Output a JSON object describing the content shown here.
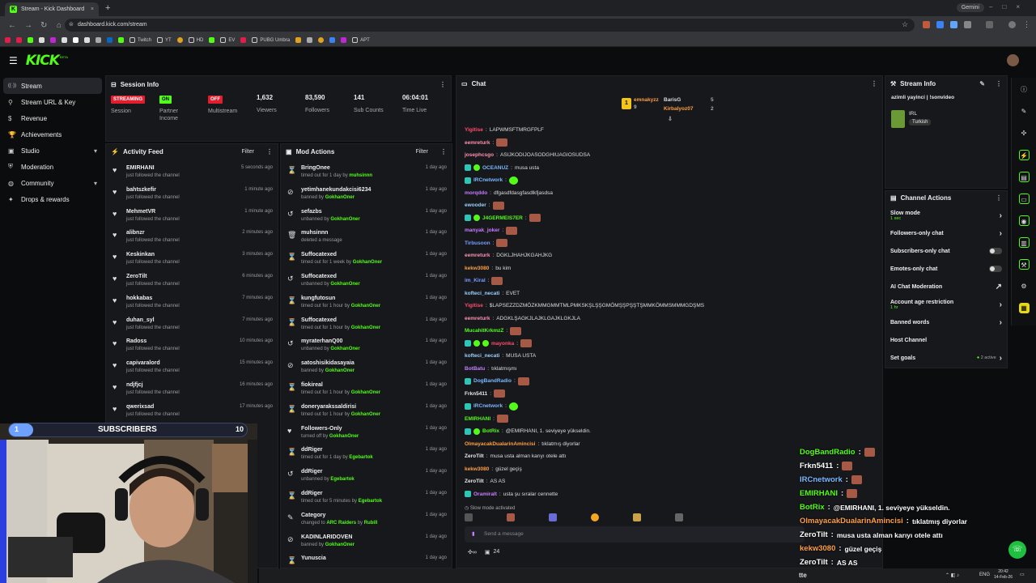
{
  "browser": {
    "tab_title": "Stream - Kick Dashboard",
    "tab_close": "×",
    "new_tab": "+",
    "url": "dashboard.kick.com/stream",
    "gemini_label": "Gemini",
    "bookmarks": [
      {
        "label": "Twitch",
        "color": "#9146ff"
      },
      {
        "label": "YT",
        "color": "#ff0000"
      },
      {
        "label": "HD",
        "color": "#e0a020"
      },
      {
        "label": "EV",
        "color": "#3b82f6"
      },
      {
        "label": "PUBG Umbra",
        "color": "#e11d48"
      },
      {
        "label": "APT",
        "color": "#aaaaaa"
      }
    ]
  },
  "app": {
    "logo": "KICK",
    "logo_beta": "BETA"
  },
  "nav": {
    "items": [
      {
        "label": "Stream",
        "icon": "stream-icon",
        "active": true
      },
      {
        "label": "Stream URL & Key",
        "icon": "key-icon"
      },
      {
        "label": "Revenue",
        "icon": "dollar-icon"
      },
      {
        "label": "Achievements",
        "icon": "trophy-icon"
      },
      {
        "label": "Studio",
        "icon": "studio-icon",
        "chevron": "▾"
      },
      {
        "label": "Moderation",
        "icon": "shield-icon"
      },
      {
        "label": "Community",
        "icon": "globe-icon",
        "chevron": "▾"
      },
      {
        "label": "Drops & rewards",
        "icon": "gift-icon"
      }
    ]
  },
  "session": {
    "title": "Session Info",
    "more": "⋮",
    "status": [
      {
        "badge": "STREAMING",
        "label": "Session",
        "color": "#e11d2e"
      },
      {
        "badge": "ON",
        "label": "Partner Income",
        "color": "#53fc18"
      },
      {
        "badge": "OFF",
        "label": "Multistream",
        "color": "#e11d2e"
      }
    ],
    "stats": [
      {
        "value": "1,632",
        "label": "Viewers"
      },
      {
        "value": "83,590",
        "label": "Followers"
      },
      {
        "value": "141",
        "label": "Sub Counts"
      },
      {
        "value": "06:04:01",
        "label": "Time Live"
      }
    ]
  },
  "activity": {
    "title": "Activity Feed",
    "filter": "Filter",
    "more": "⋮",
    "items": [
      {
        "name": "EMIRHANI",
        "sub": "just followed the channel",
        "time": "5 seconds ago"
      },
      {
        "name": "bahtszkefir",
        "sub": "just followed the channel",
        "time": "1 minute ago"
      },
      {
        "name": "MehmetVR",
        "sub": "just followed the channel",
        "time": "1 minute ago"
      },
      {
        "name": "alibnzr",
        "sub": "just followed the channel",
        "time": "2 minutes ago"
      },
      {
        "name": "Keskinkan",
        "sub": "just followed the channel",
        "time": "3 minutes ago"
      },
      {
        "name": "ZeroTilt",
        "sub": "just followed the channel",
        "time": "6 minutes ago"
      },
      {
        "name": "hokkabas",
        "sub": "just followed the channel",
        "time": "7 minutes ago"
      },
      {
        "name": "duhan_syl",
        "sub": "just followed the channel",
        "time": "7 minutes ago"
      },
      {
        "name": "Radoss",
        "sub": "just followed the channel",
        "time": "10 minutes ago"
      },
      {
        "name": "capivaralord",
        "sub": "just followed the channel",
        "time": "15 minutes ago"
      },
      {
        "name": "ndjfjcj",
        "sub": "just followed the channel",
        "time": "16 minutes ago"
      },
      {
        "name": "qwerixsad",
        "sub": "just followed the channel",
        "time": "17 minutes ago"
      }
    ]
  },
  "mod": {
    "title": "Mod Actions",
    "filter": "Filter",
    "more": "⋮",
    "items": [
      {
        "icon": "⌛",
        "name": "BringOnee",
        "pre": "timed out for 1 day by ",
        "by": "muhsinnn",
        "time": "1 day ago"
      },
      {
        "icon": "⊘",
        "name": "yetimhanekundakcisi6234",
        "pre": "banned by ",
        "by": "GokhanOner",
        "time": "1 day ago"
      },
      {
        "icon": "↺",
        "name": "sefazbs",
        "pre": "unbanned by ",
        "by": "GokhanOner",
        "time": "1 day ago"
      },
      {
        "icon": "🗑",
        "name": "muhsinnn",
        "pre": "deleted a message",
        "by": "",
        "time": "1 day ago"
      },
      {
        "icon": "⌛",
        "name": "Suffocatexed",
        "pre": "timed out for 1 week by ",
        "by": "GokhanOner",
        "time": "1 day ago"
      },
      {
        "icon": "↺",
        "name": "Suffocatexed",
        "pre": "unbanned by ",
        "by": "GokhanOner",
        "time": "1 day ago"
      },
      {
        "icon": "⌛",
        "name": "kungfutosun",
        "pre": "timed out for 1 hour by ",
        "by": "GokhanOner",
        "time": "1 day ago"
      },
      {
        "icon": "⌛",
        "name": "Suffocatexed",
        "pre": "timed out for 1 hour by ",
        "by": "GokhanOner",
        "time": "1 day ago"
      },
      {
        "icon": "↺",
        "name": "myraterhanQ00",
        "pre": "unbanned by ",
        "by": "GokhanOner",
        "time": "1 day ago"
      },
      {
        "icon": "⊘",
        "name": "satoshisikidasayaia",
        "pre": "banned by ",
        "by": "GokhanOner",
        "time": "1 day ago"
      },
      {
        "icon": "⌛",
        "name": "fiokireal",
        "pre": "timed out for 1 hour by ",
        "by": "GokhanOner",
        "time": "1 day ago"
      },
      {
        "icon": "⌛",
        "name": "doneryarakssaldirisi",
        "pre": "timed out for 1 hour by ",
        "by": "GokhanOner",
        "time": "1 day ago"
      },
      {
        "icon": "♥",
        "name": "Followers-Only",
        "pre": "turned off by ",
        "by": "GokhanOner",
        "time": "1 day ago"
      },
      {
        "icon": "⌛",
        "name": "ddRiger",
        "pre": "timed out for 1 day by ",
        "by": "Egebartok",
        "time": "1 day ago"
      },
      {
        "icon": "↺",
        "name": "ddRiger",
        "pre": "unbanned by ",
        "by": "Egebartok",
        "time": "1 day ago"
      },
      {
        "icon": "⌛",
        "name": "ddRiger",
        "pre": "timed out for 5 minutes by ",
        "by": "Egebartok",
        "time": "1 day ago"
      },
      {
        "icon": "✎",
        "name": "Category",
        "pre": "changed to ",
        "by": "ARC Raiders",
        "by2": " by ",
        "by3": "Rubill",
        "time": "1 day ago"
      },
      {
        "icon": "⊘",
        "name": "KADINLARIDOVEN",
        "pre": "banned by ",
        "by": "GokhanOner",
        "time": "1 day ago"
      },
      {
        "icon": "⌛",
        "name": "Yunuscia",
        "pre": "",
        "by": "",
        "time": "1 day ago"
      }
    ]
  },
  "chat": {
    "title": "Chat",
    "more": "⋮",
    "leaderboard": {
      "first": {
        "name": "emnakyzz",
        "count": "9"
      },
      "second": {
        "name": "BarisG",
        "count": "5"
      },
      "third": {
        "name": "Kirbalyoz07",
        "count": "2"
      }
    },
    "messages": [
      {
        "user": "Yigitise",
        "color": "#ff4d6d",
        "text": "LAPWMSFTMRGFPLF"
      },
      {
        "user": "eemreturk",
        "color": "#ff8fb0",
        "text": "",
        "emote": true
      },
      {
        "user": "josephcsgo",
        "color": "#ff8fb0",
        "text": "ASIJKODIJOASODGHIUAGIOSUDSA"
      },
      {
        "user": "OCEANUZ",
        "color": "#7ab8ff",
        "text": "musa usta",
        "badges": 2
      },
      {
        "user": "IRCnetwork",
        "color": "#7ab8ff",
        "text": "",
        "emote_green": true,
        "badges": 1
      },
      {
        "user": "morqddo",
        "color": "#c77dff",
        "text": "dfgasdfdasgfasdlkfjasdsa"
      },
      {
        "user": "ewooder",
        "color": "#9ad0ff",
        "text": "",
        "emote": true
      },
      {
        "user": "J4GERMEIS7ER",
        "color": "#53fc18",
        "text": "",
        "emote": true,
        "badges": 2
      },
      {
        "user": "manyak_joker",
        "color": "#c77dff",
        "text": "",
        "emote": true
      },
      {
        "user": "Tirbusoon",
        "color": "#7a9cff",
        "text": "",
        "emote": true
      },
      {
        "user": "eemreturk",
        "color": "#ff8fb0",
        "text": "DGKLJHAHJKGAHJKG"
      },
      {
        "user": "kekw3080",
        "color": "#ff9f43",
        "text": "bu kim"
      },
      {
        "user": "im_Kiral",
        "color": "#7a9cff",
        "text": "",
        "emote": true
      },
      {
        "user": "kofteci_necati",
        "color": "#9ad0ff",
        "text": "EVET"
      },
      {
        "user": "Yigitise",
        "color": "#ff4d6d",
        "text": "$LAPSEZZDZMÖZKMMGMMTMLPMKSKŞLŞŞGMÖMŞŞPŞŞTŞMMKÖMMSMMMGDŞMS"
      },
      {
        "user": "eemreturk",
        "color": "#ff8fb0",
        "text": "ADGKLŞAGKJLAJKLGAJKLGKJLA"
      },
      {
        "user": "MucahitKrkmzZ",
        "color": "#53fc18",
        "text": "",
        "emote": true
      },
      {
        "user": "mayonka",
        "color": "#ff4d6d",
        "text": "",
        "emote": true,
        "badges": 3
      },
      {
        "user": "kofteci_necati",
        "color": "#9ad0ff",
        "text": "MUSA USTA"
      },
      {
        "user": "BotBatu",
        "color": "#c77dff",
        "text": "tıklatmışmı"
      },
      {
        "user": "DogBandRadio",
        "color": "#7ab8ff",
        "text": "",
        "emote": true,
        "badges": 1
      },
      {
        "user": "Frkn5411",
        "color": "#e8e8e8",
        "text": "",
        "emote": true
      },
      {
        "user": "IRCnetwork",
        "color": "#7ab8ff",
        "text": "",
        "emote_green": true,
        "badges": 1
      },
      {
        "user": "EMIRHANI",
        "color": "#53fc18",
        "text": "",
        "emote": true
      },
      {
        "user": "BotRix",
        "color": "#53fc18",
        "text": "@EMIRHANI, 1. seviyeye yükseldin.",
        "badges": 2
      },
      {
        "user": "OlmayacakDualarinAmincisi",
        "color": "#ff9f43",
        "text": "tıklatmış diyorlar"
      },
      {
        "user": "ZeroTilt",
        "color": "#e8e8e8",
        "text": "musa usta alman karıyı otele attı"
      },
      {
        "user": "kekw3080",
        "color": "#ff9f43",
        "text": "güzel geçiş"
      },
      {
        "user": "ZeroTilt",
        "color": "#e8e8e8",
        "text": "AS AS"
      },
      {
        "user": "Oramiralt",
        "color": "#c77dff",
        "text": "usta şu sıralar cennette",
        "badges": 1
      }
    ],
    "slow_mode_notice": "Slow mode activated",
    "input_placeholder": "Send a message",
    "viewer_count": "24"
  },
  "stream_info": {
    "title": "Stream Info",
    "stream_title": "azimli yayinci | !sonvideo",
    "category": "IRL",
    "language": "Turkish"
  },
  "channel_actions": {
    "title": "Channel Actions",
    "items": [
      {
        "label": "Slow mode",
        "sub": "1 sec",
        "control": "›"
      },
      {
        "label": "Followers-only chat",
        "sub": "",
        "control": "›"
      },
      {
        "label": "Subscribers-only chat",
        "sub": "",
        "control": "toggle"
      },
      {
        "label": "Emotes-only chat",
        "sub": "",
        "control": "toggle"
      },
      {
        "label": "AI Chat Moderation",
        "sub": "",
        "control": "↗"
      },
      {
        "label": "Account age restriction",
        "sub": "1 hr",
        "control": "›"
      },
      {
        "label": "Banned words",
        "sub": "",
        "control": "›"
      },
      {
        "label": "Host Channel",
        "sub": "",
        "control": ""
      },
      {
        "label": "Set goals",
        "sub": "",
        "control": "›",
        "status": "2 active"
      }
    ]
  },
  "overlay": {
    "sub_goal_current": "1",
    "sub_goal_label": "SUBSCRIBERS",
    "sub_goal_target": "10",
    "sub_goal_progress": 0.1,
    "chat": [
      {
        "user": "DogBandRadio",
        "text": "",
        "color": "#53fc18"
      },
      {
        "user": "Frkn5411",
        "text": "",
        "color": "#ffffff"
      },
      {
        "user": "IRCnetwork",
        "text": "",
        "color": "#7ab8ff"
      },
      {
        "user": "EMIRHANI",
        "text": "",
        "color": "#53fc18"
      },
      {
        "user": "BotRix",
        "text": "@EMIRHANI, 1. seviyeye yükseldin.",
        "color": "#53fc18"
      },
      {
        "user": "OlmayacakDualarinAmincisi",
        "text": "tıklatmış diyorlar",
        "color": "#ff9f43"
      },
      {
        "user": "ZeroTilt",
        "text": "musa usta alman karıyı otele attı",
        "color": "#ffffff"
      },
      {
        "user": "kekw3080",
        "text": "güzel geçiş",
        "color": "#ff9f43"
      },
      {
        "user": "ZeroTilt",
        "text": "AS AS",
        "color": "#ffffff"
      }
    ]
  },
  "taskbar": {
    "lang": "ENG",
    "time": "20:42",
    "date": "14-Feb-26",
    "text_fragment": "tte"
  }
}
